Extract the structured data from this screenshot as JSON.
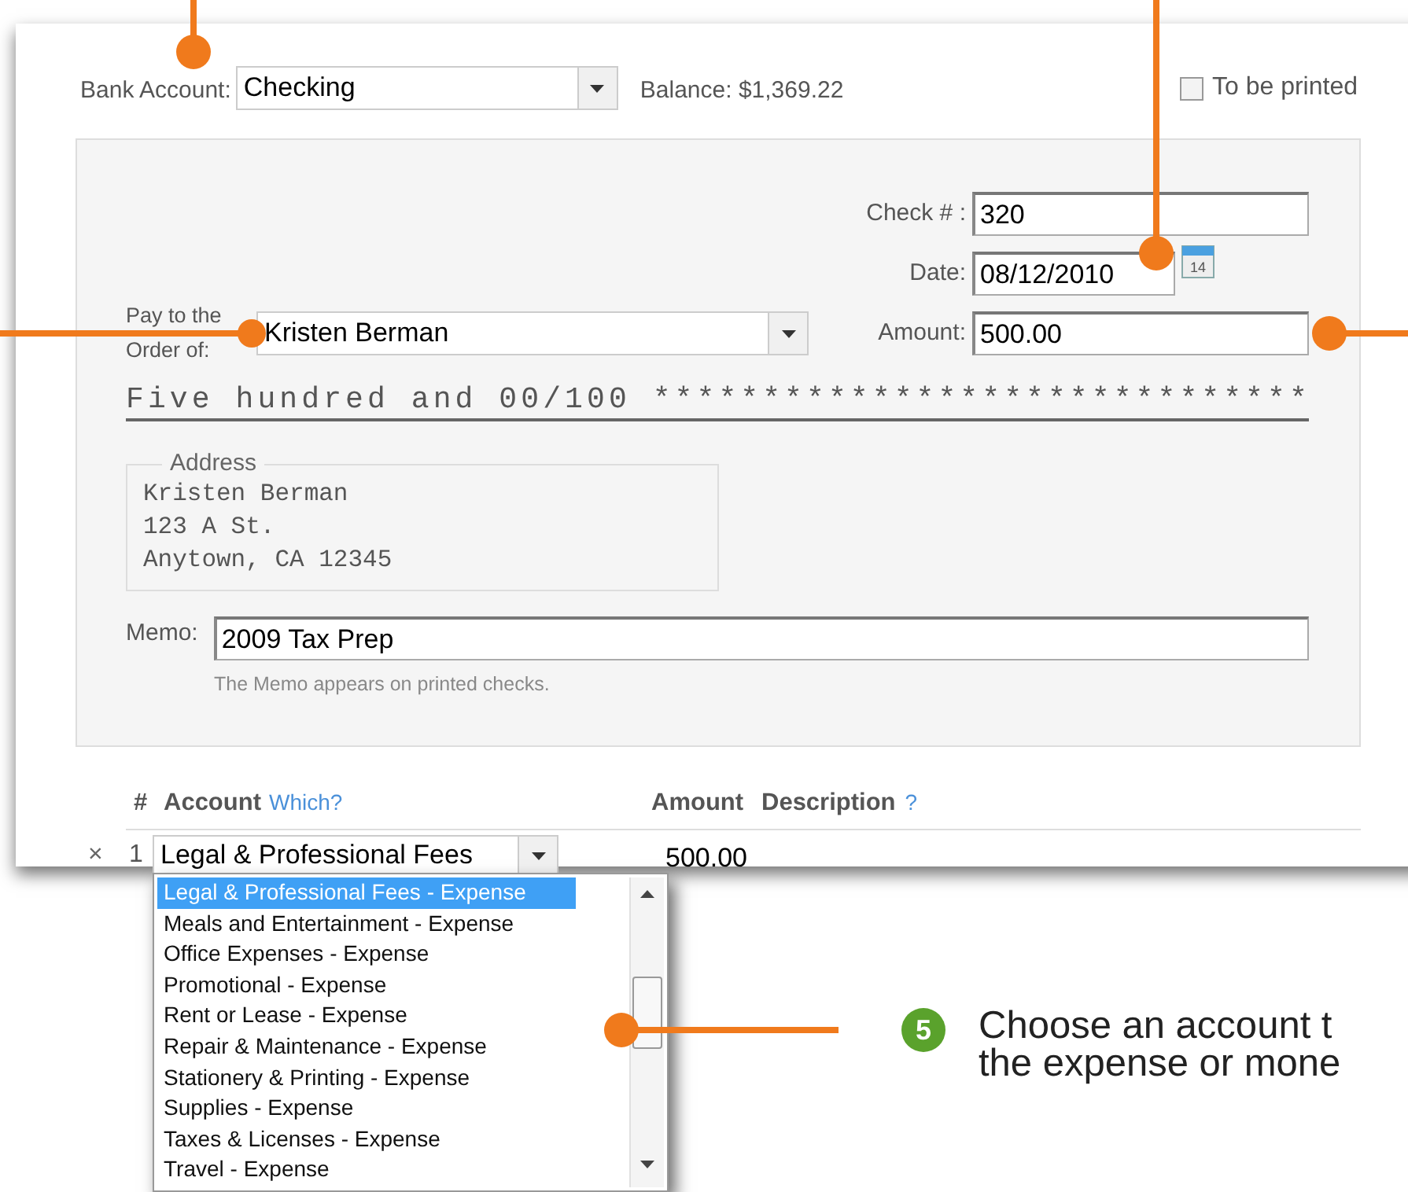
{
  "bank_account": {
    "label": "Bank Account:",
    "value": "Checking"
  },
  "balance": "Balance: $1,369.22",
  "to_be_printed": {
    "label": "To be printed",
    "checked": false
  },
  "check_number": {
    "label": "Check # :",
    "value": "320"
  },
  "date": {
    "label": "Date:",
    "value": "08/12/2010",
    "calendar_day": "14"
  },
  "payee": {
    "label": "Pay to the Order of:",
    "value": "Kristen Berman"
  },
  "amount": {
    "label": "Amount:",
    "value": "500.00"
  },
  "written_amount": "Five hundred and 00/100 ******************************",
  "address": {
    "legend": "Address",
    "lines": [
      "Kristen Berman",
      "123 A St.",
      "Anytown, CA  12345"
    ]
  },
  "memo": {
    "label": "Memo:",
    "value": "2009 Tax Prep",
    "hint": "The Memo appears on printed checks."
  },
  "splits": {
    "columns": [
      "#",
      "Account",
      "Amount",
      "Description"
    ],
    "account_help": "Which?",
    "description_help": "?",
    "rows": [
      {
        "delete": "×",
        "number": "1",
        "account": "Legal & Professional Fees",
        "amount": "500.00"
      }
    ]
  },
  "account_list": {
    "items": [
      {
        "label": "Legal & Professional Fees - Expense",
        "selected": true
      },
      {
        "label": "Meals and Entertainment - Expense",
        "selected": false
      },
      {
        "label": "Office Expenses - Expense",
        "selected": false
      },
      {
        "label": "Promotional - Expense",
        "selected": false
      },
      {
        "label": "Rent or Lease - Expense",
        "selected": false
      },
      {
        "label": "Repair & Maintenance - Expense",
        "selected": false
      },
      {
        "label": "Stationery & Printing - Expense",
        "selected": false
      },
      {
        "label": "Supplies - Expense",
        "selected": false
      },
      {
        "label": "Taxes & Licenses - Expense",
        "selected": false
      },
      {
        "label": "Travel - Expense",
        "selected": false
      }
    ]
  },
  "callout": {
    "number": "5",
    "lines": [
      "Choose an account t",
      "the expense or mone"
    ]
  }
}
